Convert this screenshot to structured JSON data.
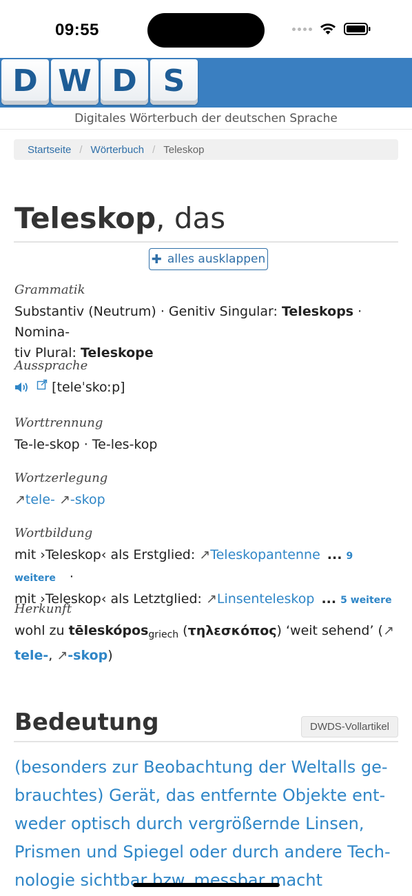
{
  "status": {
    "time": "09:55",
    "icons": [
      "signal-icon",
      "wifi-icon",
      "battery-icon"
    ]
  },
  "header": {
    "logo_letters": [
      "D",
      "W",
      "D",
      "S"
    ],
    "subtitle": "Digitales Wörterbuch der deutschen Sprache",
    "brand_color": "#3a7fc1"
  },
  "breadcrumb": {
    "items": [
      "Startseite",
      "Wörterbuch"
    ],
    "current": "Teleskop",
    "separator": "/"
  },
  "entry": {
    "lemma": "Teleskop",
    "article": ", das",
    "expand_label": "alles ausklappen"
  },
  "grammatik": {
    "label": "Grammatik",
    "line1_text": "Substantiv (Neutrum) · Genitiv Singular: ",
    "genitiv": "Teleskops",
    "line1_tail": " · Nomina-",
    "line2_text": "tiv Plural: ",
    "plural": "Teleskope"
  },
  "aussprache": {
    "label": "Aussprache",
    "ipa": "[teleˈskoːp]"
  },
  "worttrennung": {
    "label": "Worttrennung",
    "value": "Te-le-skop · Te-les-kop"
  },
  "wortzerlegung": {
    "label": "Wortzerlegung",
    "arrow": "↗",
    "part1": "tele-",
    "part2": "-skop"
  },
  "wortbildung": {
    "label": "Wortbildung",
    "row1_text": "mit ›Teleskop‹ als Erstglied: ",
    "row1_link": "Teleskopantenne",
    "row1_more": "9 weitere",
    "row2_text": "mit ›Teleskop‹ als Letztglied: ",
    "row2_link": "Linsenteleskop",
    "row2_more": "5 weitere",
    "ellipsis": "...",
    "dot": "·"
  },
  "herkunft": {
    "label": "Herkunft",
    "text1": "wohl zu ",
    "greek_translit": "tēleskópos",
    "lang": "griech",
    "text2": " (",
    "greek": "τηλεσκόπος",
    "text3": ") ‘weit sehend’ (",
    "link1": "tele-",
    "comma": ", ",
    "link2": "-skop",
    "close": ")"
  },
  "bedeutung": {
    "title": "Bedeutung",
    "badge": "DWDS-Vollartikel",
    "lines": [
      "(besonders zur Beobachtung der Weltalls ge-",
      "brauchtes) Gerät, das entfernte Objekte ent-",
      "weder optisch durch vergrößernde Linsen,",
      "Prismen und Spiegel oder durch andere Tech-",
      "nologie sichtbar bzw. messbar macht"
    ]
  }
}
